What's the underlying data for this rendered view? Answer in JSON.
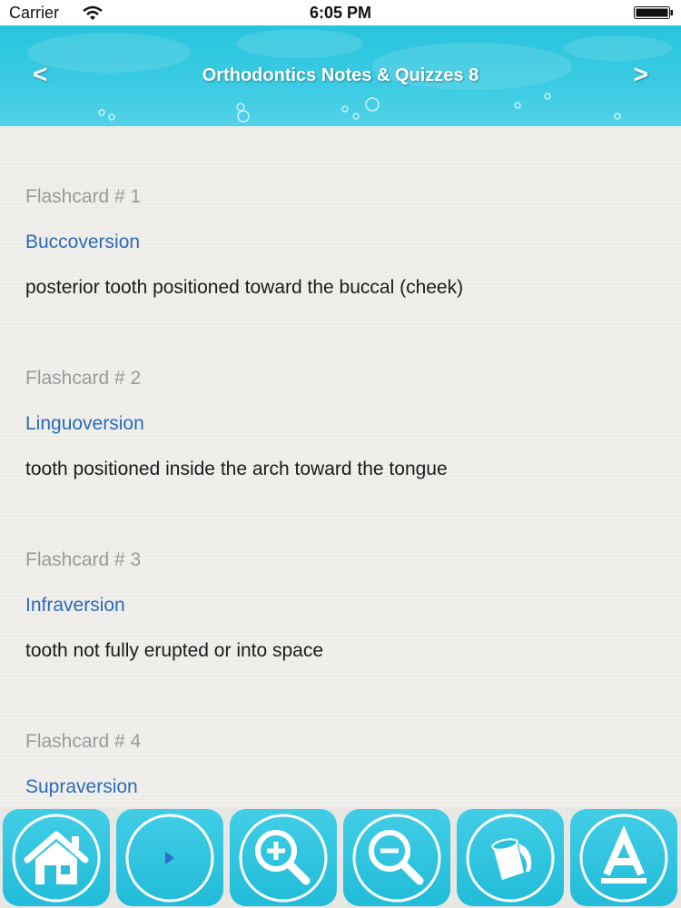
{
  "status_bar": {
    "carrier": "Carrier",
    "time": "6:05 PM"
  },
  "header": {
    "title": "Orthodontics Notes & Quizzes 8",
    "back_label": "<",
    "forward_label": ">"
  },
  "flashcards": [
    {
      "number": "Flashcard # 1",
      "term": "Buccoversion",
      "definition": "posterior tooth positioned toward the buccal (cheek)"
    },
    {
      "number": "Flashcard # 2",
      "term": "Linguoversion",
      "definition": "tooth positioned inside the arch toward the tongue"
    },
    {
      "number": "Flashcard # 3",
      "term": "Infraversion",
      "definition": "tooth not fully erupted or into space"
    },
    {
      "number": "Flashcard # 4",
      "term": "Supraversion",
      "definition": ""
    }
  ],
  "toolbar": {
    "buttons": [
      {
        "icon": "home-icon"
      },
      {
        "icon": "play-icon"
      },
      {
        "icon": "zoom-in-icon"
      },
      {
        "icon": "zoom-out-icon"
      },
      {
        "icon": "paint-bucket-icon"
      },
      {
        "icon": "font-icon"
      }
    ]
  },
  "colors": {
    "header": "#29c4de",
    "term": "#2b6bb5",
    "card_number": "#9a9a9a",
    "button": "#21bcd9"
  }
}
